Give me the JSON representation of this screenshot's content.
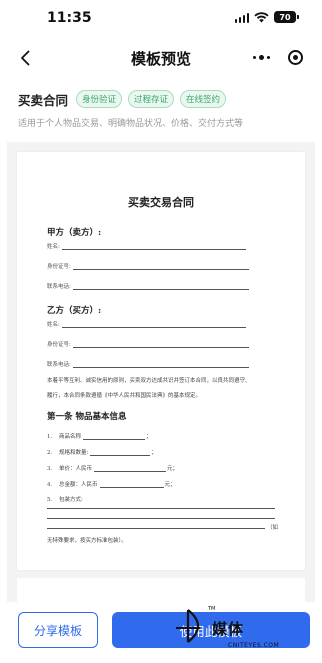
{
  "status_bar": {
    "time": "11:35",
    "battery": "70"
  },
  "nav": {
    "title": "模板预览"
  },
  "template": {
    "name": "买卖合同",
    "tags": [
      "身份验证",
      "过程存证",
      "在线签约"
    ],
    "description": "适用于个人物品交易、明确物品状况、价格、交付方式等"
  },
  "document": {
    "title": "买卖交易合同",
    "party_a": {
      "heading": "甲方（卖方）:",
      "fields": [
        "姓名:",
        "身份证号:",
        "联系电话:"
      ]
    },
    "party_b": {
      "heading": "乙方（买方）:",
      "fields": [
        "姓名:",
        "身份证号:",
        "联系电话:"
      ]
    },
    "intro_line1": "本着平等互利、诚实信用的原则，买卖双方达成共识并签订本合同，以良共同遵守、",
    "intro_line2": "履行，本合同条款遵循《中华人民共和国民法典》的基本规定。",
    "article1": {
      "heading": "第一条 物品基本信息",
      "items": [
        {
          "num": "1.",
          "label": "商品名称",
          "tail": "；"
        },
        {
          "num": "2.",
          "label": "规格和数量:",
          "tail": "；"
        },
        {
          "num": "3.",
          "label": "单价：人民币",
          "tail": "元；"
        },
        {
          "num": "4.",
          "label": "总金额：人民币",
          "tail": "元；"
        },
        {
          "num": "5.",
          "label": "包装方式:",
          "tail": ""
        }
      ],
      "paren_text": "（如",
      "footer_text": "无特殊要求，按买方标准包装）。"
    }
  },
  "bottom": {
    "share_label": "分享模板",
    "use_label": "使用此模板"
  },
  "watermark": {
    "cn": "媒体",
    "en": "CNITEYES.COM",
    "tm": "TM"
  }
}
